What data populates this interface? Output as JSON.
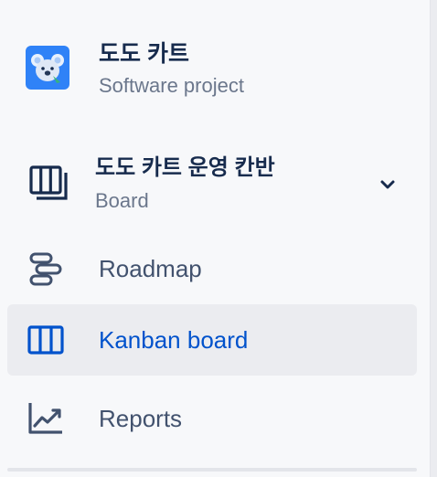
{
  "project": {
    "name": "도도 카트",
    "type": "Software project",
    "avatar_icon": "koala-icon",
    "avatar_color": "#2f82f7"
  },
  "board": {
    "name": "도도 카트 운영 칸반",
    "type": "Board",
    "icon": "board-icon",
    "expand_icon": "chevron-down-icon"
  },
  "nav": {
    "items": [
      {
        "label": "Roadmap",
        "icon": "roadmap-icon",
        "active": false
      },
      {
        "label": "Kanban board",
        "icon": "kanban-columns-icon",
        "active": true
      },
      {
        "label": "Reports",
        "icon": "reports-chart-icon",
        "active": false
      }
    ]
  },
  "colors": {
    "text_primary": "#172b4d",
    "text_secondary": "#6b778c",
    "nav_text": "#42526e",
    "active_text": "#0052cc",
    "active_bg": "#ebecf0",
    "sidebar_bg": "#f7f8fa"
  }
}
